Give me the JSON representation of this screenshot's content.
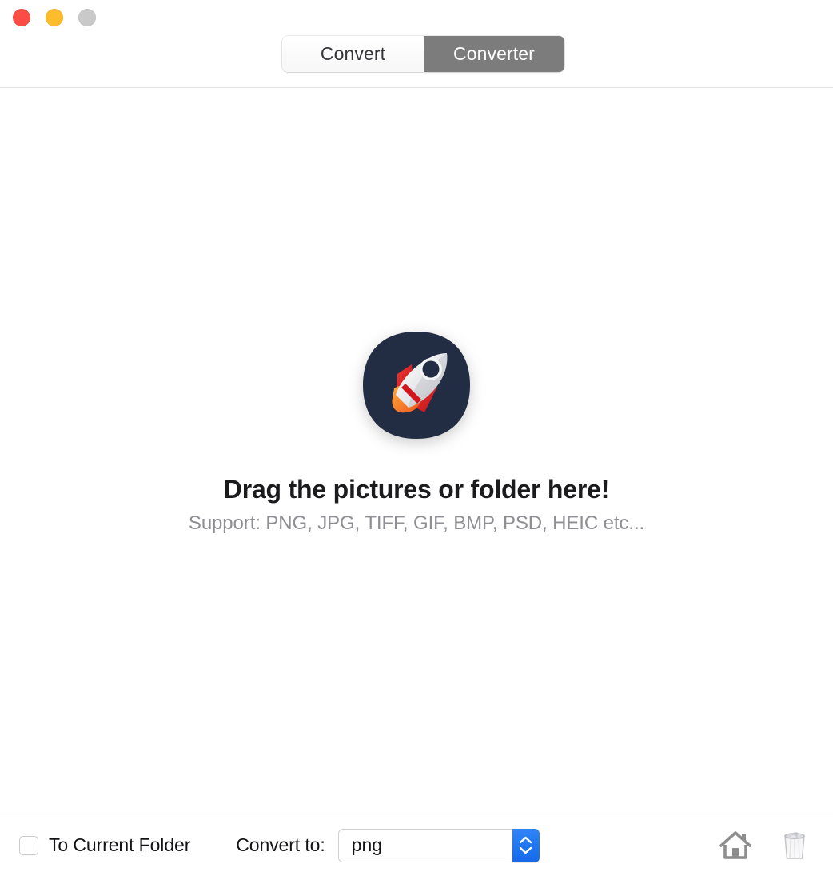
{
  "window": {
    "traffic_lights": [
      {
        "name": "close",
        "color": "#fb4c45"
      },
      {
        "name": "minimize",
        "color": "#fdbc2c"
      },
      {
        "name": "zoom",
        "color": "#c9c9c9"
      }
    ]
  },
  "toolbar": {
    "segments": [
      {
        "label": "Convert",
        "active": false
      },
      {
        "label": "Converter",
        "active": true
      }
    ],
    "active_color": "#7c7c7c",
    "active_text_color": "#ffffff",
    "inactive_text_color": "#35353a"
  },
  "drop_area": {
    "icon": "rocket-app-icon",
    "icon_colors": {
      "background": "#222c42",
      "body": "#e9eaec",
      "window": "#222c42",
      "fin": "#e01f26",
      "flame": "#f5852a"
    },
    "title": "Drag the pictures or folder here!",
    "subtitle": "Support: PNG, JPG, TIFF, GIF, BMP, PSD, HEIC etc..."
  },
  "bottom_bar": {
    "to_current_folder": {
      "label": "To Current Folder",
      "checked": false
    },
    "convert_to": {
      "label": "Convert to:",
      "value": "png",
      "stepper_color": "#1b7ff5"
    },
    "actions": [
      {
        "name": "home-icon",
        "label": "Home"
      },
      {
        "name": "trash-icon",
        "label": "Trash"
      }
    ]
  }
}
